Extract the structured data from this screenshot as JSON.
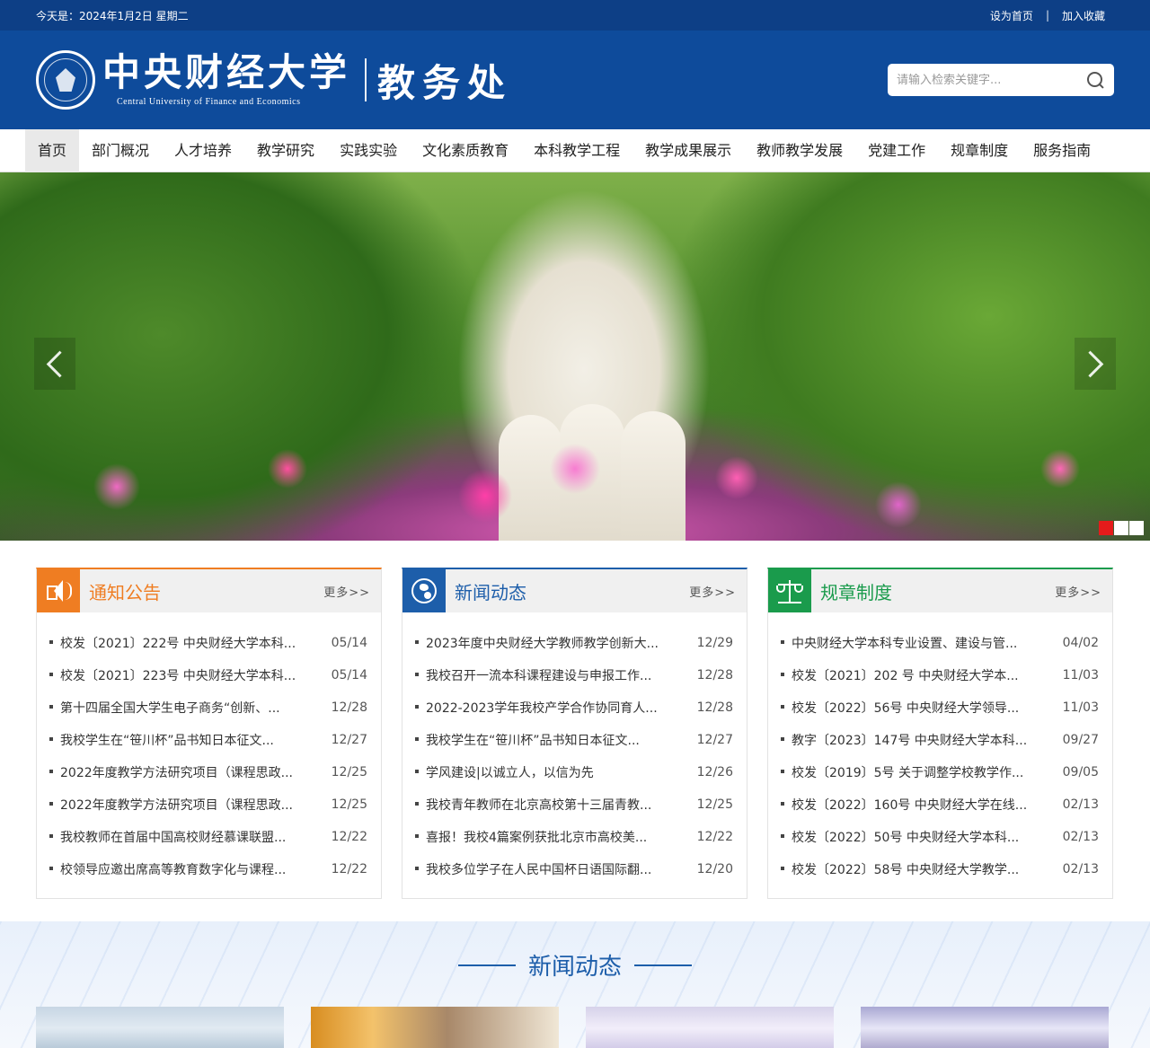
{
  "topbar": {
    "date_text": "今天是：2024年1月2日  星期二",
    "set_home": "设为首页",
    "separator": "|",
    "bookmark": "加入收藏"
  },
  "header": {
    "school_cn": "中央财经大学",
    "school_en": "Central University of Finance and Economics",
    "dept": "教务处",
    "search_placeholder": "请输入检索关键字..."
  },
  "nav": {
    "items": [
      "首页",
      "部门概况",
      "人才培养",
      "教学研究",
      "实践实验",
      "文化素质教育",
      "本科教学工程",
      "教学成果展示",
      "教师教学发展",
      "党建工作",
      "规章制度",
      "服务指南"
    ]
  },
  "banner": {
    "dot_count": 3,
    "active_dot": 1
  },
  "columns": [
    {
      "title": "通知公告",
      "more": "更多>>",
      "icon": "speaker-icon",
      "color": "#ef7d22",
      "items": [
        {
          "title": "校发〔2021〕222号 中央财经大学本科...",
          "date": "05/14"
        },
        {
          "title": "校发〔2021〕223号 中央财经大学本科...",
          "date": "05/14"
        },
        {
          "title": "第十四届全国大学生电子商务“创新、...",
          "date": "12/28"
        },
        {
          "title": "我校学生在“笹川杯”品书知日本征文...",
          "date": "12/27"
        },
        {
          "title": "2022年度教学方法研究项目（课程思政...",
          "date": "12/25"
        },
        {
          "title": "2022年度教学方法研究项目（课程思政...",
          "date": "12/25"
        },
        {
          "title": "我校教师在首届中国高校财经慕课联盟...",
          "date": "12/22"
        },
        {
          "title": "校领导应邀出席高等教育数字化与课程...",
          "date": "12/22"
        }
      ]
    },
    {
      "title": "新闻动态",
      "more": "更多>>",
      "icon": "globe-icon",
      "color": "#1d5eaa",
      "items": [
        {
          "title": "2023年度中央财经大学教师教学创新大...",
          "date": "12/29"
        },
        {
          "title": "我校召开一流本科课程建设与申报工作...",
          "date": "12/28"
        },
        {
          "title": "2022-2023学年我校产学合作协同育人...",
          "date": "12/28"
        },
        {
          "title": "我校学生在“笹川杯”品书知日本征文...",
          "date": "12/27"
        },
        {
          "title": "学风建设|以诚立人，以信为先",
          "date": "12/26"
        },
        {
          "title": "我校青年教师在北京高校第十三届青教...",
          "date": "12/25"
        },
        {
          "title": "喜报！我校4篇案例获批北京市高校美...",
          "date": "12/22"
        },
        {
          "title": "我校多位学子在人民中国杯日语国际翻...",
          "date": "12/20"
        }
      ]
    },
    {
      "title": "规章制度",
      "more": "更多>>",
      "icon": "scale-icon",
      "color": "#1a9b4c",
      "items": [
        {
          "title": "中央财经大学本科专业设置、建设与管...",
          "date": "04/02"
        },
        {
          "title": "校发〔2021〕202 号 中央财经大学本...",
          "date": "11/03"
        },
        {
          "title": "校发〔2022〕56号 中央财经大学领导...",
          "date": "11/03"
        },
        {
          "title": "教字〔2023〕147号 中央财经大学本科...",
          "date": "09/27"
        },
        {
          "title": "校发〔2019〕5号 关于调整学校教学作...",
          "date": "09/05"
        },
        {
          "title": "校发〔2022〕160号 中央财经大学在线...",
          "date": "02/13"
        },
        {
          "title": "校发〔2022〕50号 中央财经大学本科...",
          "date": "02/13"
        },
        {
          "title": "校发〔2022〕58号 中央财经大学教学...",
          "date": "02/13"
        }
      ]
    }
  ],
  "news_section": {
    "title": "新闻动态"
  }
}
